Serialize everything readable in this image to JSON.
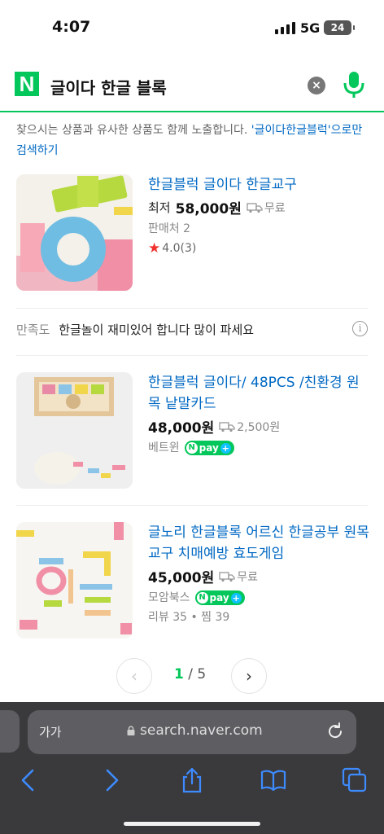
{
  "status_bar": {
    "time": "4:07",
    "network": "5G",
    "battery": "24"
  },
  "search": {
    "logo": "N",
    "query": "글이다 한글 블록",
    "clear_icon": "×"
  },
  "notice": {
    "text": "찾으시는 상품과 유사한 상품도 함께 노출합니다. ",
    "link": "'글이다한글블럭'으로만 검색하기"
  },
  "products": [
    {
      "title": "한글블럭 글이다 한글교구",
      "price_prefix": "최저",
      "price": "58,000원",
      "shipping": "무료",
      "sub": "판매처 2",
      "rating": "4.0",
      "rating_count": "(3)"
    },
    {
      "title": "한글블럭 글이다/ 48PCS /친환경 원목 낱말카드",
      "price": "48,000원",
      "shipping": "2,500원",
      "seller": "베트윈",
      "npay": "pay"
    },
    {
      "title": "글노리 한글블록 어르신 한글공부 원목교구 치매예방 효도게임",
      "price": "45,000원",
      "shipping": "무료",
      "seller": "모암북스",
      "npay": "pay",
      "extra": "리뷰 35 • 찜 39"
    }
  ],
  "review": {
    "label": "만족도",
    "text": "한글놀이 재미있어 합니다 많이 파세요",
    "info_icon": "i"
  },
  "pagination": {
    "current": "1",
    "separator": " / ",
    "total": "5",
    "prev": "‹",
    "next": "›"
  },
  "browser": {
    "text_size": "가가",
    "url": "search.naver.com"
  },
  "colors": {
    "naver_green": "#03c75a",
    "link_blue": "#0068c3",
    "safari_bar": "#3a3a3c",
    "toolbar_blue": "#3d8bff"
  }
}
